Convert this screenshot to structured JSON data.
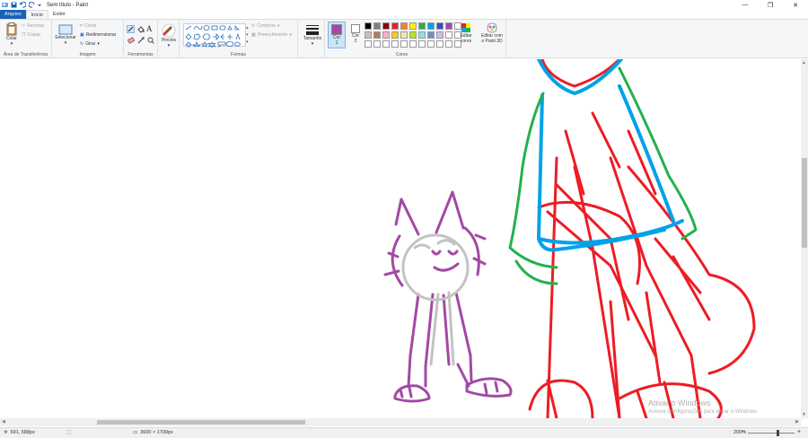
{
  "window": {
    "title": "Sem título - Paint",
    "minimize": "—",
    "maximize": "❐",
    "close": "✕"
  },
  "tabs": [
    {
      "label": "Arquivo"
    },
    {
      "label": "Início"
    },
    {
      "label": "Exibir"
    }
  ],
  "ribbon": {
    "clipboard": {
      "label": "Área de Transferência",
      "paste": "Colar",
      "cut": "Recortar",
      "copy": "Copiar"
    },
    "image": {
      "label": "Imagem",
      "select": "Selecionar",
      "crop": "Cortar",
      "resize": "Redimensionar",
      "rotate": "Girar"
    },
    "tools": {
      "label": "Ferramentas",
      "brushes": "Pincéis"
    },
    "shapes": {
      "label": "Formas",
      "outline": "Contorno",
      "fill": "Preenchimento",
      "size": "Tamanho"
    },
    "colors": {
      "label": "Cores",
      "color1": "Cor 1",
      "color1_short": "Cor",
      "color1_num": "1",
      "color2_short": "Cor",
      "color2_num": "2",
      "edit_colors": "Editar cores",
      "edit_line1": "Editar",
      "edit_line2": "cores",
      "paint3d_line1": "Editar com",
      "paint3d_line2": "o Paint 3D",
      "palette": [
        "#000000",
        "#7f7f7f",
        "#880015",
        "#ed1c24",
        "#ff7f27",
        "#fff200",
        "#22b14c",
        "#00a2e8",
        "#3f48cc",
        "#a349a4",
        "#ffffff",
        "#c3c3c3",
        "#b97a57",
        "#ffaec9",
        "#ffc90e",
        "#efe4b0",
        "#b5e61d",
        "#99d9ea",
        "#7092be",
        "#c8bfe7"
      ],
      "color1_value": "#a349a4",
      "color2_value": "#ffffff"
    }
  },
  "watermark": {
    "line1": "Ativar o Windows",
    "line2": "Acesse Configurações para ativar o Windows."
  },
  "status": {
    "cursor": "691, 688px",
    "size": "3600 × 1700px",
    "zoom": "200%"
  }
}
